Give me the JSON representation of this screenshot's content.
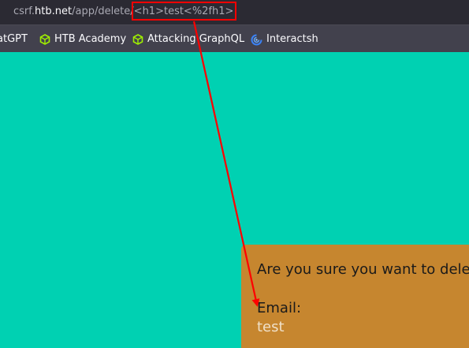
{
  "url": {
    "prefix": "csrf.",
    "host": "htb.net",
    "path": "/app/delete/",
    "payload": "<h1>test<%2fh1>"
  },
  "bookmarks": [
    {
      "label": "atGPT"
    },
    {
      "label": "HTB Academy"
    },
    {
      "label": "Attacking GraphQL"
    },
    {
      "label": "Interactsh"
    }
  ],
  "page": {
    "confirm_text": "Are you sure you want to delete",
    "email_label": "Email:",
    "email_value": "test"
  },
  "colors": {
    "page_bg": "#00d1b2",
    "dialog_bg": "#c6862f",
    "annotation": "#ff0000",
    "htb_icon": "#9fef00",
    "interactsh_icon": "#3b82f6"
  },
  "icons": [
    "htb-cube-icon",
    "htb-cube-icon",
    "interactsh-icon"
  ]
}
